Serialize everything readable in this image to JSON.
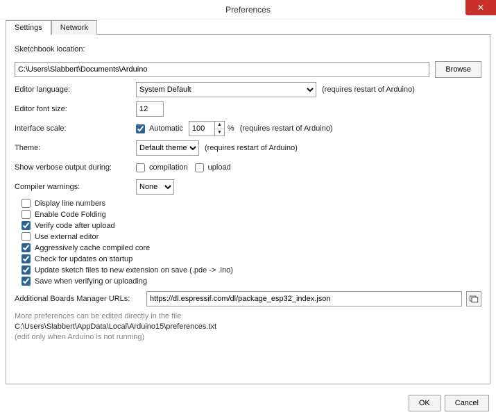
{
  "window": {
    "title": "Preferences",
    "close_glyph": "✕"
  },
  "tabs": {
    "settings": "Settings",
    "network": "Network"
  },
  "panel": {
    "sketchbook_label": "Sketchbook location:",
    "sketchbook_value": "C:\\Users\\Slabbert\\Documents\\Arduino",
    "browse": "Browse",
    "editor_language_label": "Editor language:",
    "editor_language_value": "System Default",
    "restart_note": "(requires restart of Arduino)",
    "editor_font_size_label": "Editor font size:",
    "editor_font_size_value": "12",
    "interface_scale_label": "Interface scale:",
    "automatic_label": "Automatic",
    "scale_value": "100",
    "percent": "%",
    "theme_label": "Theme:",
    "theme_value": "Default theme",
    "verbose_label": "Show verbose output during:",
    "compilation_label": "compilation",
    "upload_label": "upload",
    "compiler_warnings_label": "Compiler warnings:",
    "compiler_warnings_value": "None",
    "chk_display_line_numbers": "Display line numbers",
    "chk_code_folding": "Enable Code Folding",
    "chk_verify_after_upload": "Verify code after upload",
    "chk_external_editor": "Use external editor",
    "chk_cache_core": "Aggressively cache compiled core",
    "chk_check_updates": "Check for updates on startup",
    "chk_update_ext": "Update sketch files to new extension on save (.pde -> .ino)",
    "chk_save_on_verify": "Save when verifying or uploading",
    "boards_label": "Additional Boards Manager URLs:",
    "boards_value": "https://dl.espressif.com/dl/package_esp32_index.json",
    "more_prefs_1": "More preferences can be edited directly in the file",
    "more_prefs_path": "C:\\Users\\Slabbert\\AppData\\Local\\Arduino15\\preferences.txt",
    "more_prefs_2": "(edit only when Arduino is not running)"
  },
  "buttons": {
    "ok": "OK",
    "cancel": "Cancel"
  },
  "checks": {
    "automatic": true,
    "compilation": false,
    "upload": false,
    "display_line_numbers": false,
    "code_folding": false,
    "verify_after_upload": true,
    "external_editor": false,
    "cache_core": true,
    "check_updates": true,
    "update_ext": true,
    "save_on_verify": true
  }
}
